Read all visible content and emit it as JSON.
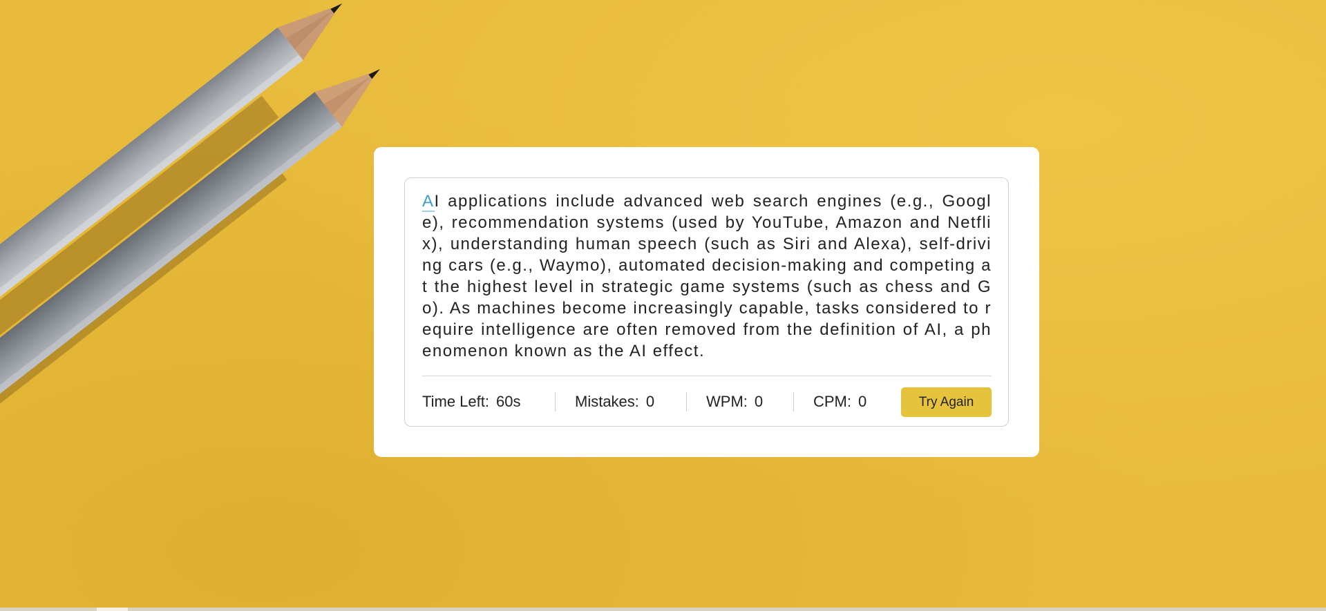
{
  "typing": {
    "active_char": "A",
    "rest_text": "I applications include advanced web search engines (e.g., Google), recommendation systems (used by YouTube, Amazon and Netflix), understanding human speech (such as Siri and Alexa), self-driving cars (e.g., Waymo), automated decision-making and competing at the highest level in strategic game systems (such as chess and Go). As machines become increasingly capable, tasks considered to require intelligence are often removed from the definition of AI, a phenomenon known as the AI effect."
  },
  "stats": {
    "time_left_label": "Time Left:",
    "time_left_value": "60s",
    "mistakes_label": "Mistakes:",
    "mistakes_value": "0",
    "wpm_label": "WPM:",
    "wpm_value": "0",
    "cpm_label": "CPM:",
    "cpm_value": "0"
  },
  "buttons": {
    "try_again_label": "Try Again"
  },
  "colors": {
    "background": "#e8bb3c",
    "accent_button": "#e6c33d",
    "active_char": "#3f9fbf"
  }
}
